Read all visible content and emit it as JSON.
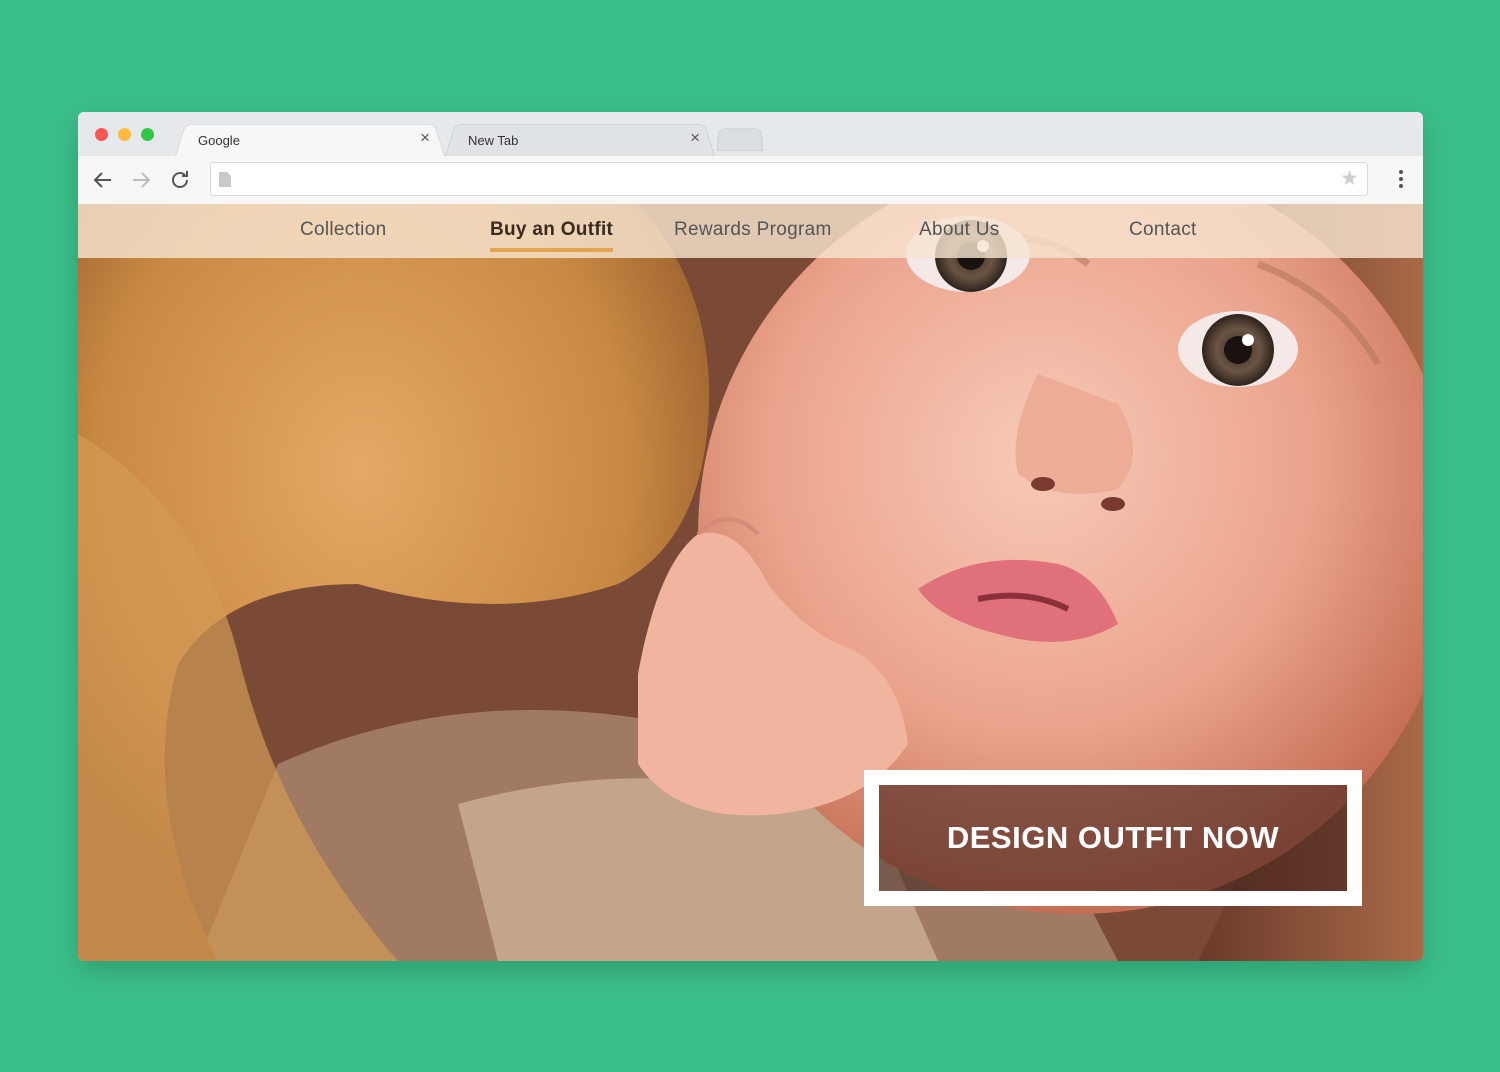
{
  "tabs": [
    {
      "title": "Google",
      "close": "×",
      "active": true
    },
    {
      "title": "New Tab",
      "close": "×",
      "active": false
    }
  ],
  "toolbar": {
    "back_icon": "arrow-left-icon",
    "forward_icon": "arrow-right-icon",
    "reload_icon": "reload-icon",
    "address_value": "",
    "bookmark_icon": "star-icon",
    "menu_icon": "vertical-dots-icon"
  },
  "site": {
    "nav": [
      "Collection",
      "Buy an Outfit",
      "Rewards Program",
      "About Us",
      "Contact"
    ],
    "active_nav": "Buy an Outfit",
    "cta_label": "DESIGN OUTFIT NOW"
  },
  "colors": {
    "background": "#3bbf8a",
    "accent": "#e2a453",
    "nav_bar": "#f6e4d0"
  }
}
